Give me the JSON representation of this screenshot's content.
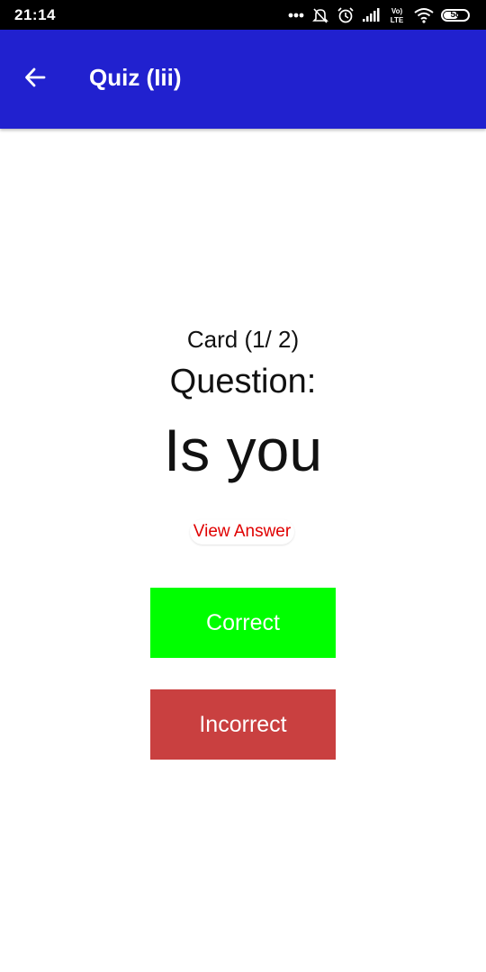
{
  "status_bar": {
    "time": "21:14",
    "battery": "58",
    "battery_level": 0.58,
    "network_label_top": "Vo)",
    "network_label_bottom": "LTE",
    "icons": [
      "more-dots-icon",
      "alarm-off-icon",
      "alarm-icon",
      "signal-icon",
      "volte-icon",
      "wifi-icon",
      "battery-icon"
    ]
  },
  "app_bar": {
    "title": "Quiz (Iii)",
    "back_icon": "arrow-back-icon",
    "color": "#2121cf"
  },
  "card": {
    "counter": "Card (1/ 2)",
    "question_label": "Question:",
    "question_text": "Is you"
  },
  "actions": {
    "view_answer_label": "View Answer",
    "view_answer_color": "#e00000",
    "correct_label": "Correct",
    "correct_color": "#00ff00",
    "incorrect_label": "Incorrect",
    "incorrect_color": "#c94040"
  }
}
